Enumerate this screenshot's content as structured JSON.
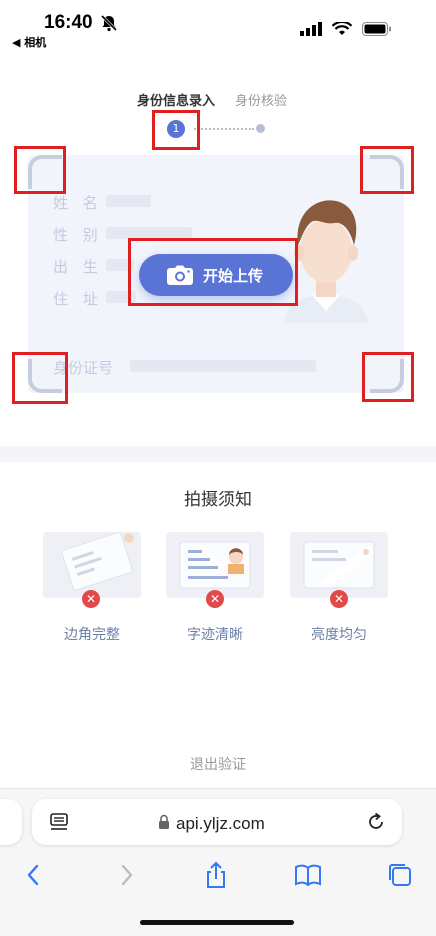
{
  "status_bar": {
    "time": "16:40",
    "back_app": "◀ 相机"
  },
  "steps": {
    "step1_label": "身份信息录入",
    "step2_label": "身份核验",
    "step1_number": "1"
  },
  "id_card": {
    "fields": [
      "姓 名",
      "性 别",
      "出 生",
      "住 址"
    ],
    "id_number_label": "身份证号"
  },
  "upload_button": {
    "label": "开始上传"
  },
  "notice": {
    "title": "拍摄须知",
    "tips": [
      {
        "label": "边角完整",
        "icon": "close-x-icon"
      },
      {
        "label": "字迹清晰",
        "icon": "close-x-icon"
      },
      {
        "label": "亮度均匀",
        "icon": "close-x-icon"
      }
    ]
  },
  "exit_link": "退出验证",
  "browser": {
    "url": "api.yljz.com"
  },
  "colors": {
    "accent": "#5a74d6",
    "error": "#e04a4a",
    "highlight": "#e02020"
  }
}
